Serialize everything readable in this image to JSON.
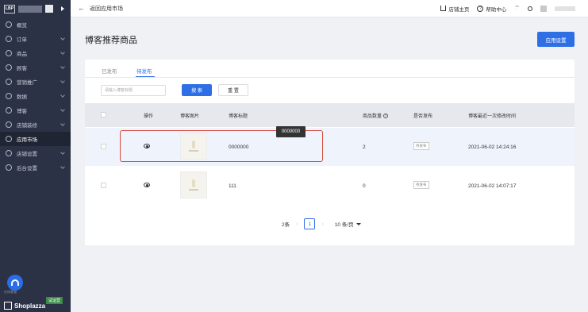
{
  "sidebar": {
    "brand_logo": "LBP",
    "items": [
      {
        "label": "概览",
        "icon": "overview-icon",
        "chevron": false
      },
      {
        "label": "订单",
        "icon": "order-icon",
        "chevron": true
      },
      {
        "label": "商品",
        "icon": "product-icon",
        "chevron": true
      },
      {
        "label": "顾客",
        "icon": "customer-icon",
        "chevron": true
      },
      {
        "label": "营销推广",
        "icon": "marketing-icon",
        "chevron": true
      },
      {
        "label": "数据",
        "icon": "data-icon",
        "chevron": true
      },
      {
        "label": "博客",
        "icon": "blog-icon",
        "chevron": true
      },
      {
        "label": "店铺装修",
        "icon": "decoration-icon",
        "chevron": true
      },
      {
        "label": "应用市场",
        "icon": "app-market-icon",
        "chevron": false,
        "active": true
      },
      {
        "label": "店铺设置",
        "icon": "store-settings-icon",
        "chevron": true
      },
      {
        "label": "后台设置",
        "icon": "admin-settings-icon",
        "chevron": true
      }
    ],
    "support_label": "在线客服",
    "footer_brand": "Shoplazza",
    "footer_badge": "试运营"
  },
  "topbar": {
    "back_label": "返回应用市场",
    "store_home": "店铺主页",
    "help_center": "帮助中心"
  },
  "page": {
    "title": "博客推荐商品",
    "settings_button": "应用设置"
  },
  "tabs": [
    {
      "label": "已发布",
      "active": false
    },
    {
      "label": "待发布",
      "active": true
    }
  ],
  "search": {
    "placeholder": "请输入博客标题",
    "search_button": "搜 索",
    "reset_button": "重 置"
  },
  "table": {
    "headers": {
      "action": "操作",
      "image": "博客图片",
      "title": "博客标题",
      "count": "商品数量",
      "published": "是否发布",
      "modified": "博客最近一次修改时间"
    },
    "rows": [
      {
        "title": "0000000",
        "count": "2",
        "status": "待发布",
        "modified": "2021-06-02 14:24:16"
      },
      {
        "title": "111",
        "count": "0",
        "status": "待发布",
        "modified": "2021-06-02 14:07:17"
      }
    ]
  },
  "tooltip_text": "0000000",
  "pagination": {
    "total": "2条",
    "current": "1",
    "page_size": "10 条/页"
  },
  "colors": {
    "accent": "#2f6fe6",
    "sidebar_bg": "#2b3245",
    "highlight": "#d64a3c"
  }
}
